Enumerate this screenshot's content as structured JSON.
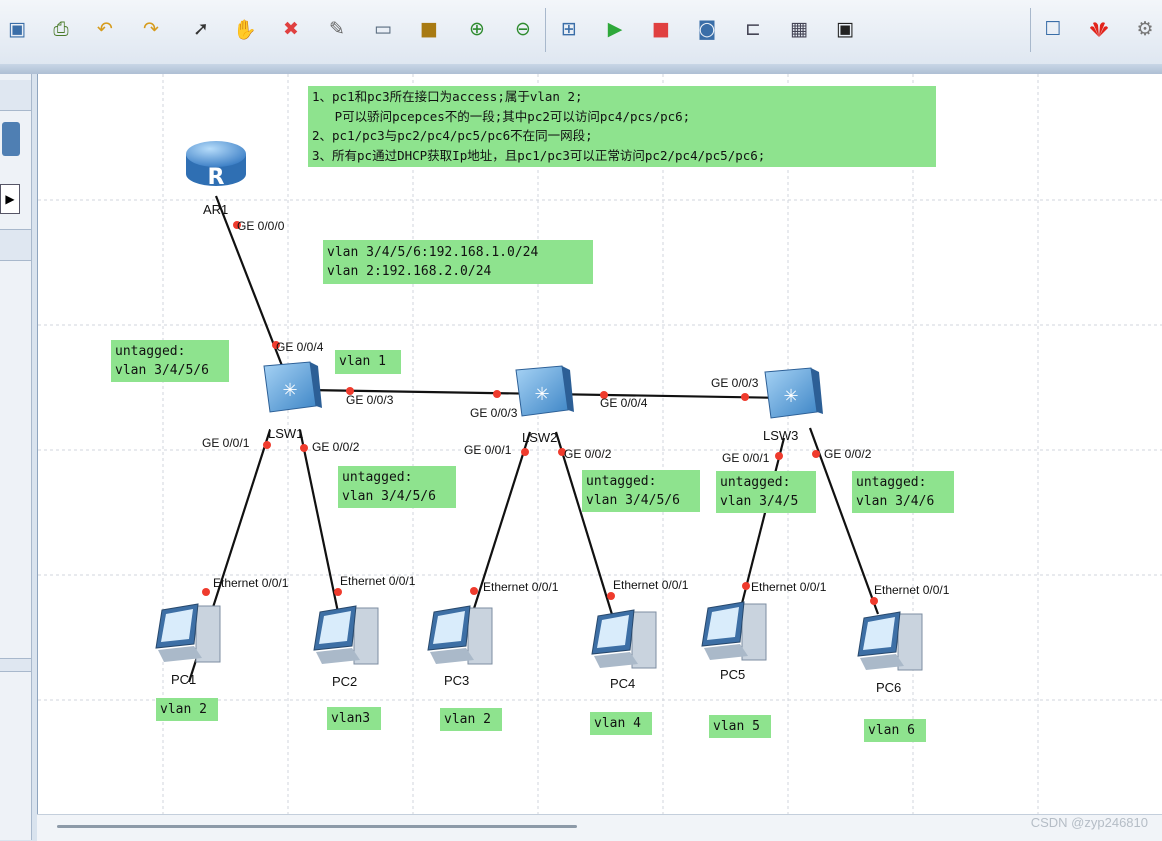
{
  "toolbar": {
    "buttons": [
      "save-icon",
      "print-icon",
      "undo-icon",
      "redo-icon",
      "select-pointer-icon",
      "hand-pan-icon",
      "delete-icon",
      "eraser-icon",
      "text-note-icon",
      "rectangle-icon",
      "zoom-in-icon",
      "zoom-out-icon",
      "fit-topology-icon",
      "start-device-icon",
      "stop-device-icon",
      "capture-icon",
      "topology-icon",
      "grid-icon",
      "console-icon"
    ],
    "right_buttons": [
      "chat-icon",
      "huawei-logo-icon",
      "settings-icon"
    ],
    "huawei_color": "#e2231a"
  },
  "notes": {
    "requirements": [
      "1、pc1和pc3所在接口为access;属于vlan 2;",
      "   P可以骄问pcepces不的一段;其中pc2可以访问pc4/pcs/pc6;",
      "2、pc1/pc3与pc2/pc4/pc5/pc6不在同一网段;",
      "3、所有pc通过DHCP获取Ip地址，且pc1/pc3可以正常访问pc2/pc4/pc5/pc6;"
    ],
    "subnets": [
      "vlan 3/4/5/6:192.168.1.0/24",
      "vlan 2:192.168.2.0/24"
    ],
    "lsw1_left": [
      "untagged:",
      "vlan 3/4/5/6"
    ],
    "lsw1_vlan": "vlan 1",
    "lsw1_down": [
      "untagged:",
      "vlan 3/4/5/6"
    ],
    "lsw2_down": [
      "untagged:",
      "vlan 3/4/5/6"
    ],
    "lsw3_left": [
      "untagged:",
      "vlan 3/4/5"
    ],
    "lsw3_right": [
      "untagged:",
      "vlan 3/4/6"
    ],
    "pc_vlans": [
      "vlan 2",
      "vlan3",
      "vlan 2",
      "vlan 4",
      "vlan 5",
      "vlan 6"
    ]
  },
  "devices": {
    "ar1": "AR1",
    "lsw1": "LSW1",
    "lsw2": "LSW2",
    "lsw3": "LSW3",
    "pcs": [
      "PC1",
      "PC2",
      "PC3",
      "PC4",
      "PC5",
      "PC6"
    ]
  },
  "ports": {
    "ar1_ge000": "GE 0/0/0",
    "lsw1_ge004": "GE 0/0/4",
    "lsw1_ge003": "GE 0/0/3",
    "lsw1_ge001": "GE 0/0/1",
    "lsw1_ge002": "GE 0/0/2",
    "lsw2_ge003": "GE 0/0/3",
    "lsw2_ge004": "GE 0/0/4",
    "lsw2_ge001": "GE 0/0/1",
    "lsw2_ge002": "GE 0/0/2",
    "lsw3_ge003": "GE 0/0/3",
    "lsw3_ge001": "GE 0/0/1",
    "lsw3_ge002": "GE 0/0/2",
    "pc_eth": "Ethernet 0/0/1"
  },
  "watermark": "CSDN @zyp246810"
}
